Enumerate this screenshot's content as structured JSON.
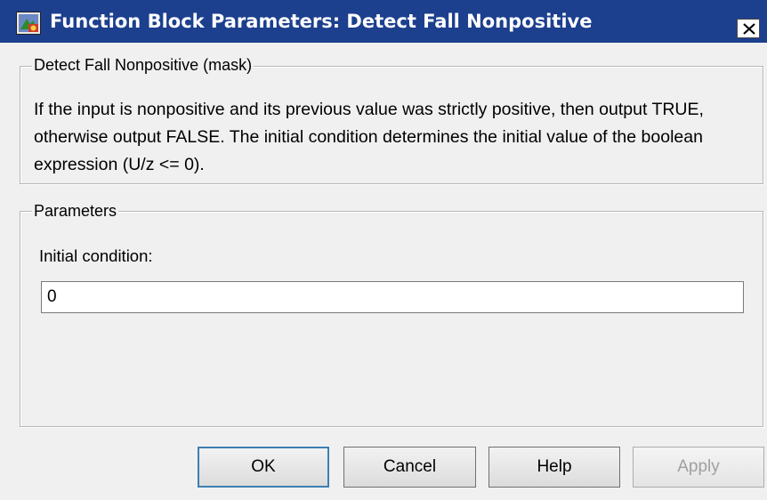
{
  "window": {
    "title": "Function Block Parameters: Detect Fall Nonpositive",
    "icon": "simulink-block-icon",
    "close_glyph": "✕"
  },
  "mask_group": {
    "legend": "Detect Fall Nonpositive (mask)",
    "description": "If the input is nonpositive and its previous value was strictly positive, then output TRUE, otherwise output FALSE.  The initial condition determines the initial value of the boolean expression (U/z <= 0)."
  },
  "parameters_group": {
    "legend": "Parameters",
    "initial_condition": {
      "label": "Initial condition:",
      "value": "0"
    }
  },
  "buttons": {
    "ok": "OK",
    "cancel": "Cancel",
    "help": "Help",
    "apply": "Apply"
  },
  "colors": {
    "titlebar": "#1c3f8e",
    "dialog_bg": "#f0f0f0",
    "default_button_border": "#3c7fb1"
  }
}
